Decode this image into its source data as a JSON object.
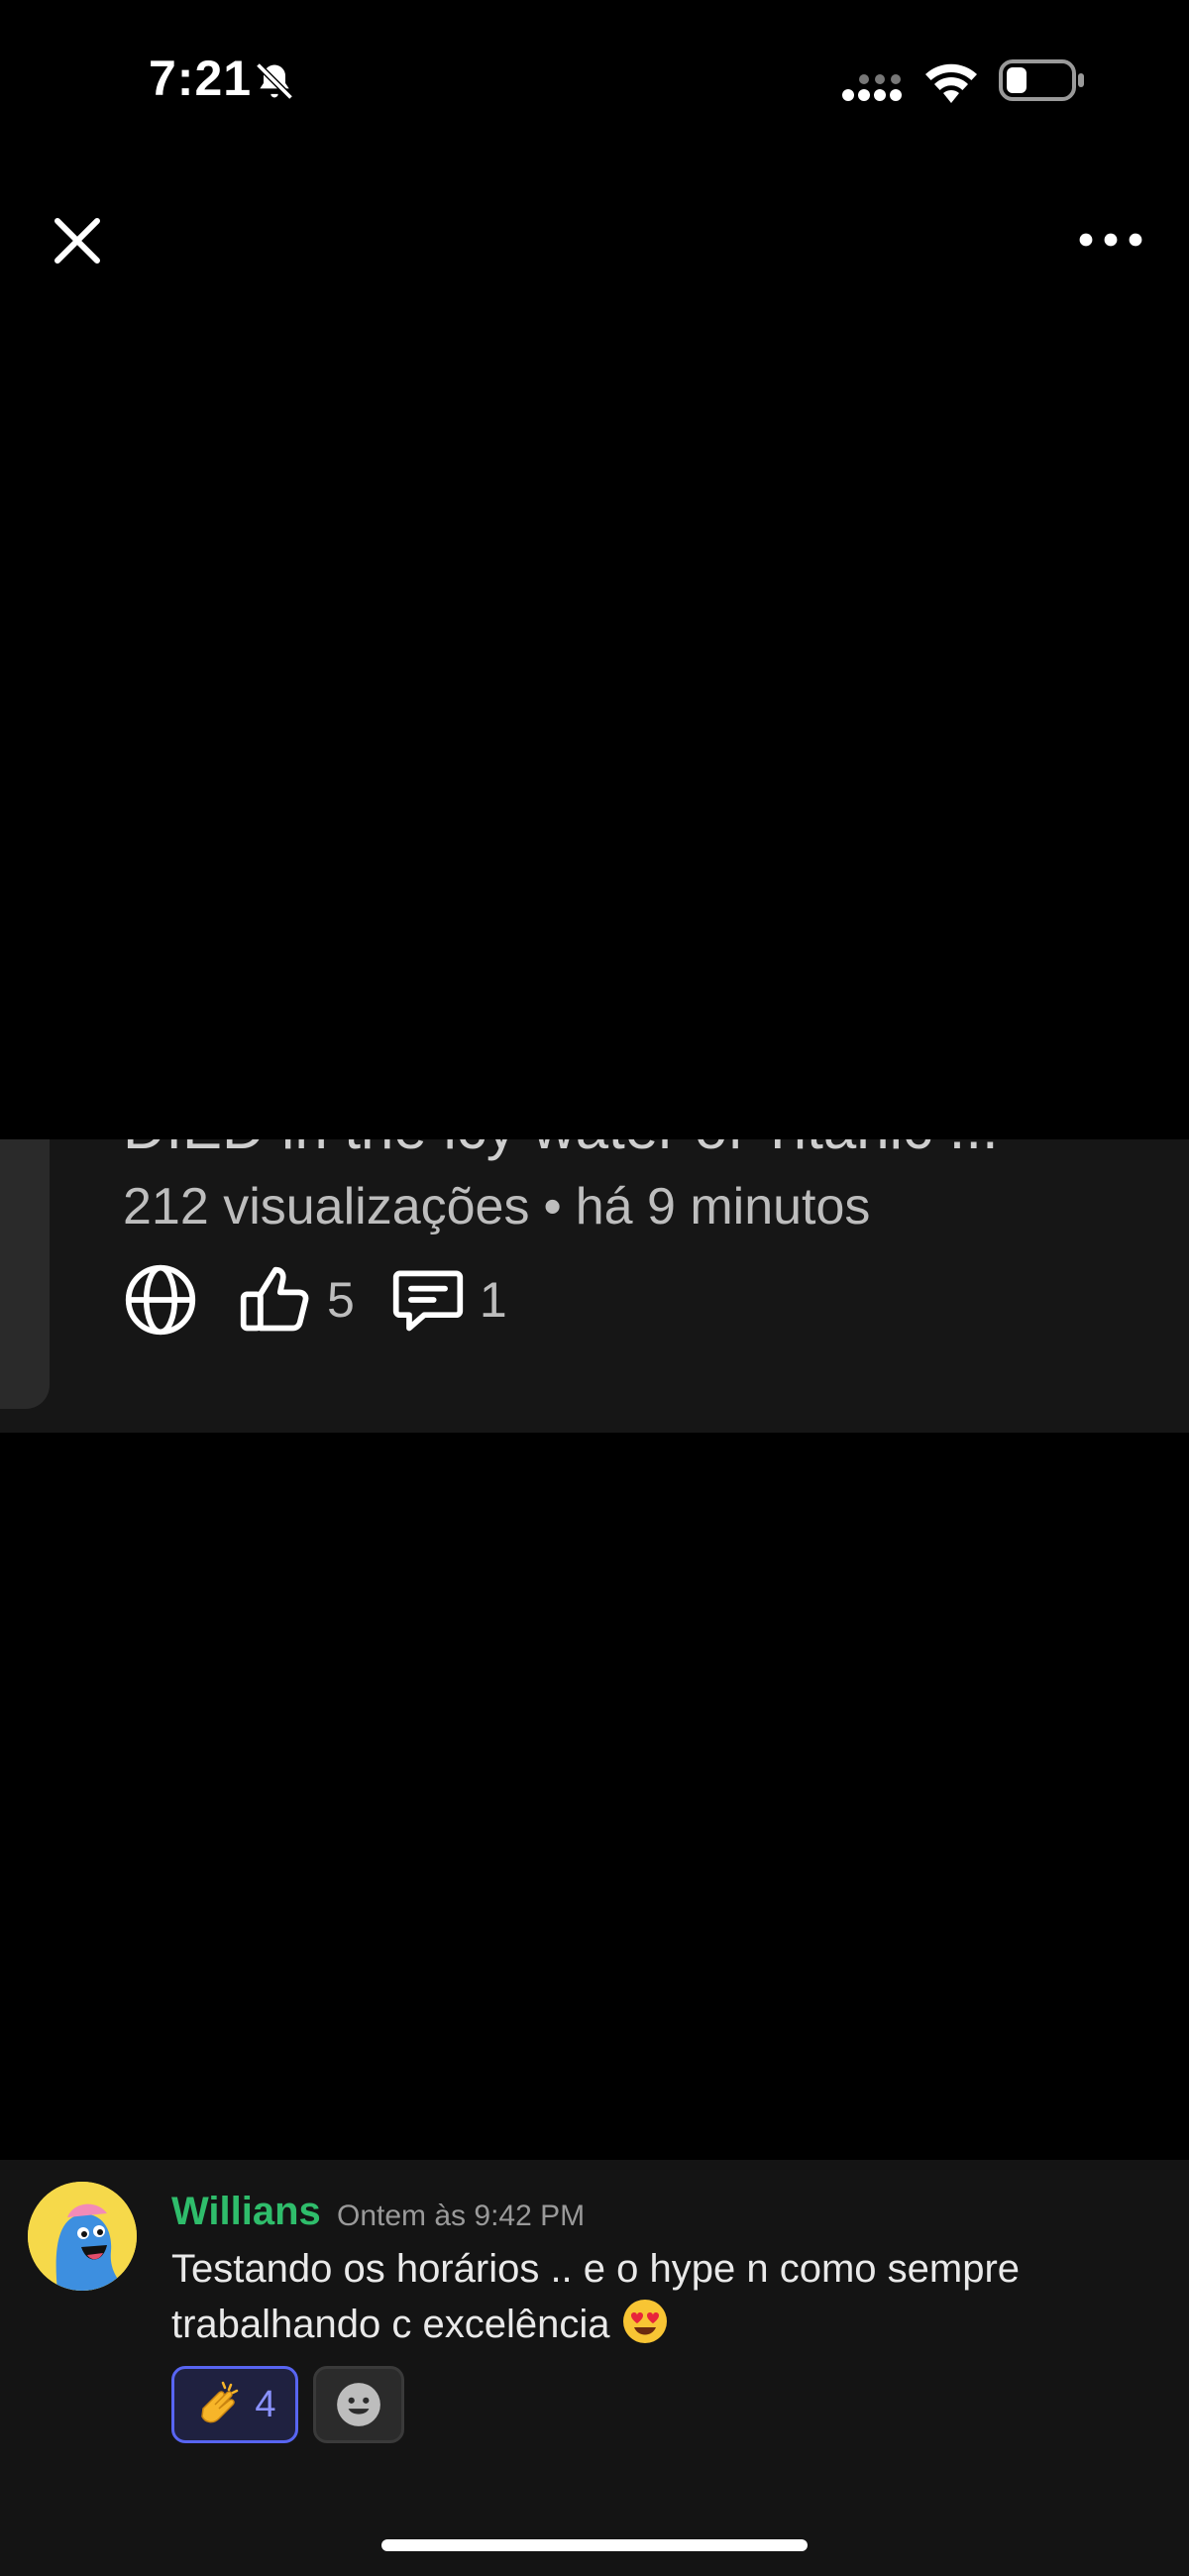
{
  "status_bar": {
    "time": "7:21"
  },
  "top_bar": {
    "close_icon": "close-icon",
    "more_icon": "more-options-icon"
  },
  "video_card": {
    "title_clipped": "DIED in the icy water of Titanic ...",
    "views": "212 visualizações",
    "separator": "•",
    "time_ago": "há 9 minutos",
    "like_count": "5",
    "comment_count": "1"
  },
  "message": {
    "author": "Willians",
    "author_color": "#2fbd6b",
    "timestamp": "Ontem às 9:42 PM",
    "text": "Testando os horários .. e o hype n como sempre trabalhando c excelência",
    "reaction": {
      "emoji": "clapping-hands",
      "count": "4"
    }
  }
}
